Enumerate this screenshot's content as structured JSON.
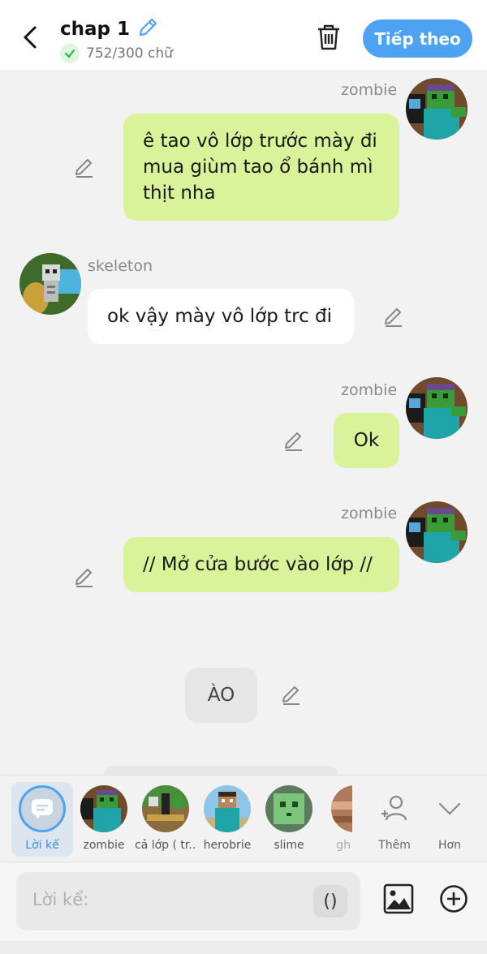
{
  "header": {
    "title": "chap 1",
    "word_count": "752/300 chữ",
    "next_label": "Tiếp theo"
  },
  "messages": [
    {
      "speaker": "zombie",
      "text": "ê tao vô lớp trước mày đi mua giùm tao ổ bánh mì thịt nha"
    },
    {
      "speaker": "skeleton",
      "text": "ok vậy mày vô lớp trc đi"
    },
    {
      "speaker": "zombie",
      "text": "Ok"
    },
    {
      "speaker": "zombie",
      "text": "// Mở cửa bước vào lớp //"
    },
    {
      "speaker": "",
      "text": "ÀO"
    }
  ],
  "picker": {
    "items": [
      {
        "label": "Lời kể"
      },
      {
        "label": "zombie"
      },
      {
        "label": "cả lớp ( tr..."
      },
      {
        "label": "herobrie"
      },
      {
        "label": "slime"
      },
      {
        "label": "gh"
      }
    ],
    "more_label": "Thêm",
    "collapse_label": "Hơn"
  },
  "input": {
    "placeholder": "Lời kể:",
    "paren_label": "()"
  },
  "colors": {
    "accent": "#4da3f1",
    "bubble_green": "#d8f39a",
    "background": "#f2f2f2"
  }
}
